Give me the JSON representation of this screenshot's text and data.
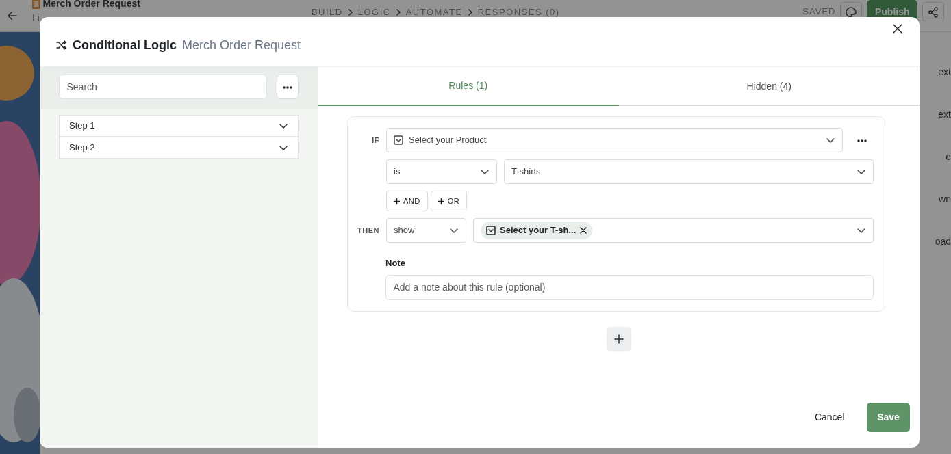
{
  "app": {
    "form_title": "Merch Order Request",
    "form_subtitle": "Li",
    "steps": [
      {
        "label": "BUILD"
      },
      {
        "label": "LOGIC"
      },
      {
        "label": "AUTOMATE"
      },
      {
        "label": "RESPONSES (0)"
      }
    ],
    "saved": "SAVED",
    "publish": "Publish",
    "side_items": [
      "ext",
      "ext",
      "e",
      "wn",
      "oad"
    ]
  },
  "modal": {
    "title": "Conditional Logic",
    "subtitle": "Merch Order Request",
    "search": {
      "placeholder": "Search"
    },
    "sidebar": [
      {
        "label": "Step 1",
        "expanded": false
      },
      {
        "label": "Step 2",
        "expanded": false
      }
    ],
    "tabs": [
      {
        "label": "Rules (1)",
        "selected": true
      },
      {
        "label": "Hidden (4)",
        "selected": false
      }
    ],
    "rule": {
      "if_label": "IF",
      "field": "Select your Product",
      "operator": "is",
      "value": "T-shirts",
      "and": "AND",
      "or": "OR",
      "then_label": "THEN",
      "action": "show",
      "targets": [
        {
          "label": "Select your T-sh..."
        }
      ],
      "note_label": "Note",
      "note_placeholder": "Add a note about this rule (optional)"
    },
    "cancel": "Cancel",
    "save": "Save"
  }
}
